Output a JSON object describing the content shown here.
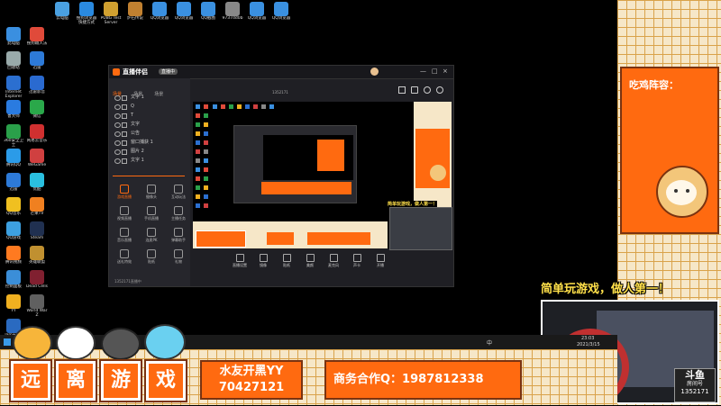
{
  "desktop": {
    "icons": [
      {
        "label": "此电脑",
        "color": "#3a8fe0"
      },
      {
        "label": "回收站",
        "color": "#9aa"
      },
      {
        "label": "Internet Explorer",
        "color": "#2b6fd0"
      },
      {
        "label": "鲁大师",
        "color": "#2a7be0"
      },
      {
        "label": "360安全卫士",
        "color": "#2aa04a"
      },
      {
        "label": "腾讯QQ",
        "color": "#2b9be8"
      },
      {
        "label": "迅雷",
        "color": "#2d7ad8"
      },
      {
        "label": "QQ音乐",
        "color": "#f0c020"
      },
      {
        "label": "QQ游戏",
        "color": "#3da0e0"
      },
      {
        "label": "腾讯视频",
        "color": "#ff7a20"
      },
      {
        "label": "控制面板",
        "color": "#3b8ed8"
      },
      {
        "label": "YY",
        "color": "#f0b020"
      },
      {
        "label": "lamweb-1253",
        "color": "#2a6ac0"
      }
    ],
    "col2_icons": [
      {
        "label": "搜狗输入法",
        "color": "#e04a3a"
      },
      {
        "label": "迅雷",
        "color": "#2d7ad8"
      },
      {
        "label": "迅雷影音",
        "color": "#2a6ad0"
      },
      {
        "label": "微信",
        "color": "#2aa84a"
      },
      {
        "label": "网易云音乐",
        "color": "#d03030"
      },
      {
        "label": "WeGame",
        "color": "#d04040"
      },
      {
        "label": "优酷",
        "color": "#2ac0e0"
      },
      {
        "label": "芒果TV",
        "color": "#f08020"
      },
      {
        "label": "Steam",
        "color": "#203050"
      },
      {
        "label": "英雄联盟",
        "color": "#c09030"
      },
      {
        "label": "Dead Cells",
        "color": "#802030"
      },
      {
        "label": "World War Z",
        "color": "#606060"
      }
    ],
    "top_icons": [
      {
        "label": "云电脑",
        "color": "#4aa0e0"
      },
      {
        "label": "搜狗浏览器 快捷方式",
        "color": "#2a8ae0"
      },
      {
        "label": "PUBG Test Server",
        "color": "#d0a030"
      },
      {
        "label": "炉石传说",
        "color": "#c08030"
      },
      {
        "label": "QQ浏览器",
        "color": "#3a90e0"
      },
      {
        "label": "QQ浏览器",
        "color": "#3a90e0"
      },
      {
        "label": "QQ截图",
        "color": "#3a90e0"
      },
      {
        "label": "9737dd0b",
        "color": "#888"
      },
      {
        "label": "QQ浏览器",
        "color": "#3a90e0"
      },
      {
        "label": "QQ浏览器",
        "color": "#3a90e0"
      }
    ]
  },
  "app": {
    "title": "直播伴侣",
    "scene_tabs": [
      "场景",
      "场景",
      "场景"
    ],
    "toolbar_status": "直播中",
    "sources": [
      "文字 1",
      "Q",
      "T",
      "文字",
      "公告",
      "窗口捕获 1",
      "图片 2",
      "文字 1"
    ],
    "tool_buttons": [
      "游戏直播",
      "摄像头",
      "互动玩法",
      "视频直播",
      "手机直播",
      "主播任务",
      "音乐直播",
      "连麦PK",
      "弹幕助手",
      "送礼特效",
      "贴纸",
      "礼物"
    ],
    "bottom_buttons": [
      "直播设置",
      "镜像",
      "贴纸",
      "美颜",
      "麦克风",
      "声卡",
      "开播"
    ],
    "stats": "1352171",
    "status_line": "1352171直播中"
  },
  "overlay": {
    "tiles": [
      "远",
      "离",
      "游",
      "戏"
    ],
    "yy_title": "水友开黑YY",
    "yy_number": "70427121",
    "business": "商务合作Q：1987812338",
    "slogan": "简单玩游戏，做人第一！",
    "eat_chicken": "吃鸡阵容：",
    "room_logo": "斗鱼",
    "room_label": "房间号",
    "room_number": "1352171"
  },
  "taskbar": {
    "time": "23:03",
    "date": "2021/3/15",
    "lang": "中"
  },
  "colors": {
    "orange": "#ff6a10",
    "frame_bg": "#f6e7c8",
    "grid": "#d9a24a",
    "slogan": "#ffe04a"
  }
}
